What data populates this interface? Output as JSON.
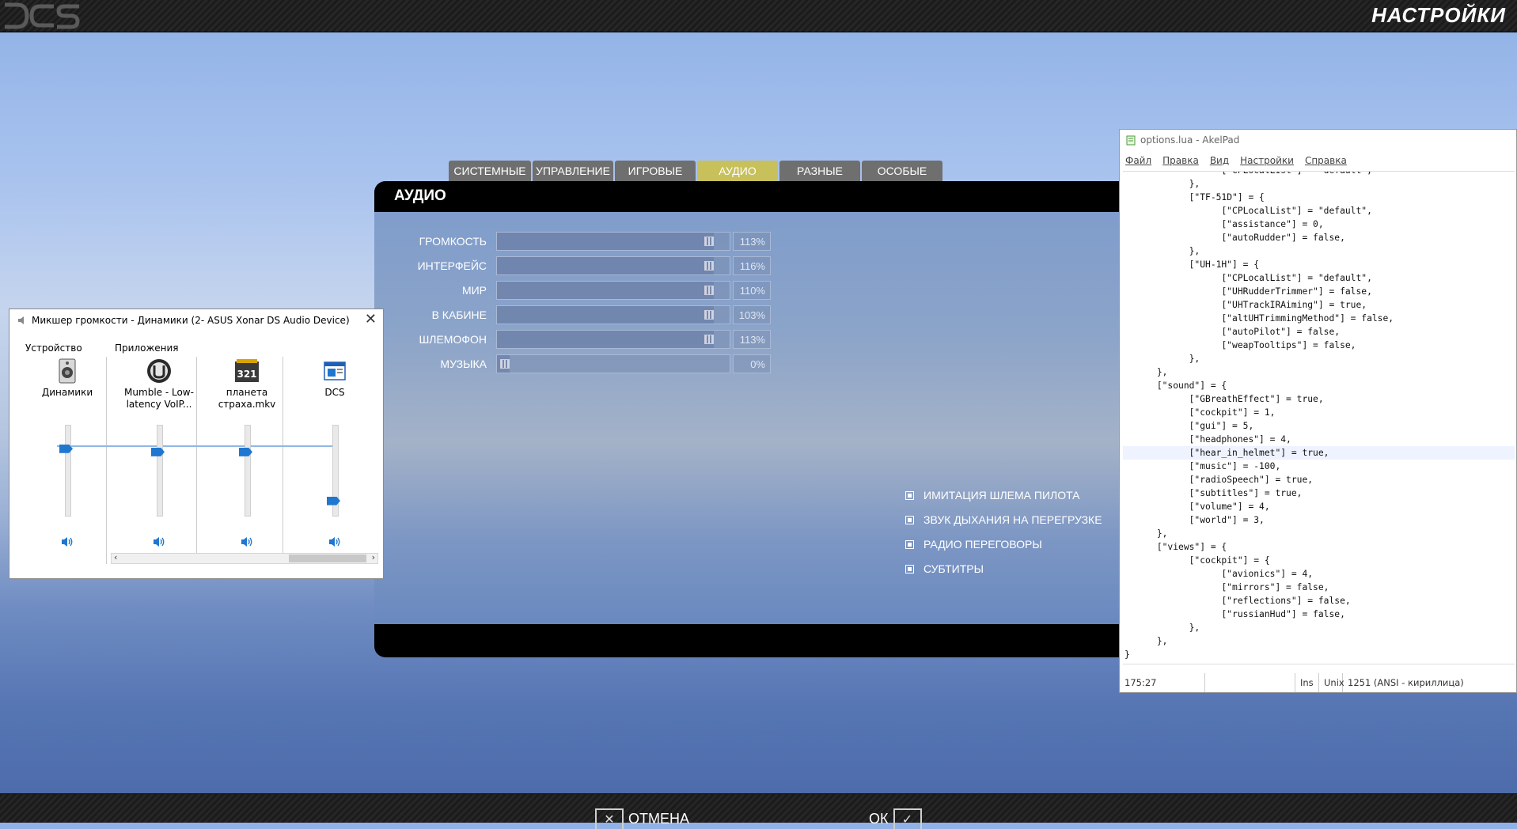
{
  "app": {
    "header_title": "НАСТРОЙКИ"
  },
  "tabs": [
    {
      "label": "СИСТЕМНЫЕ",
      "active": false
    },
    {
      "label": "УПРАВЛЕНИЕ",
      "active": false
    },
    {
      "label": "ИГРОВЫЕ",
      "active": false
    },
    {
      "label": "АУДИО",
      "active": true
    },
    {
      "label": "РАЗНЫЕ",
      "active": false
    },
    {
      "label": "ОСОБЫЕ",
      "active": false
    }
  ],
  "audio": {
    "title": "АУДИО",
    "sliders": [
      {
        "label": "ГРОМКОСТЬ",
        "value": "113%",
        "level": 0.94
      },
      {
        "label": "ИНТЕРФЕЙС",
        "value": "116%",
        "level": 0.94
      },
      {
        "label": "МИР",
        "value": "110%",
        "level": 0.94
      },
      {
        "label": "В КАБИНЕ",
        "value": "103%",
        "level": 0.94
      },
      {
        "label": "ШЛЕМОФОН",
        "value": "113%",
        "level": 0.94
      },
      {
        "label": "МУЗЫКА",
        "value": "0%",
        "level": 0.0
      }
    ],
    "checkboxes": [
      {
        "label": "ИМИТАЦИЯ ШЛЕМА ПИЛОТА",
        "checked": true
      },
      {
        "label": "ЗВУК ДЫХАНИЯ НА ПЕРЕГРУЗКЕ",
        "checked": true
      },
      {
        "label": "РАДИО ПЕРЕГОВОРЫ",
        "checked": true
      },
      {
        "label": "СУБТИТРЫ",
        "checked": true
      }
    ]
  },
  "bottom": {
    "cancel_label": "ОТМЕНА",
    "ok_label": "ОК"
  },
  "mixer": {
    "title": "Микшер громкости - Динамики (2- ASUS Xonar DS Audio Device)",
    "device_section": "Устройство",
    "apps_section": "Приложения",
    "channels": [
      {
        "name": "Динамики",
        "icon": "speaker-device-icon",
        "level": 0.76
      },
      {
        "name": "Mumble - Low-latency VoIP...",
        "icon": "mumble-icon",
        "level": 0.72
      },
      {
        "name": "планета страха.mkv",
        "icon": "media-player-icon",
        "level": 0.72
      },
      {
        "name": "DCS",
        "icon": "dcs-window-icon",
        "level": 0.12
      }
    ]
  },
  "editor": {
    "title": "options.lua - AkelPad",
    "menu": [
      "Файл",
      "Правка",
      "Вид",
      "Настройки",
      "Справка"
    ],
    "code": "\t\t\t[\"CPLocalList\"] = \"default\",\n\t\t},\n\t\t[\"TF-51D\"] = {\n\t\t\t[\"CPLocalList\"] = \"default\",\n\t\t\t[\"assistance\"] = 0,\n\t\t\t[\"autoRudder\"] = false,\n\t\t},\n\t\t[\"UH-1H\"] = {\n\t\t\t[\"CPLocalList\"] = \"default\",\n\t\t\t[\"UHRudderTrimmer\"] = false,\n\t\t\t[\"UHTrackIRAiming\"] = true,\n\t\t\t[\"altUHTrimmingMethod\"] = false,\n\t\t\t[\"autoPilot\"] = false,\n\t\t\t[\"weapTooltips\"] = false,\n\t\t},\n\t},\n\t[\"sound\"] = {\n\t\t[\"GBreathEffect\"] = true,\n\t\t[\"cockpit\"] = 1,\n\t\t[\"gui\"] = 5,\n\t\t[\"headphones\"] = 4,\n\t\t[\"hear_in_helmet\"] = true,\n\t\t[\"music\"] = -100,\n\t\t[\"radioSpeech\"] = true,\n\t\t[\"subtitles\"] = true,\n\t\t[\"volume\"] = 4,\n\t\t[\"world\"] = 3,\n\t},\n\t[\"views\"] = {\n\t\t[\"cockpit\"] = {\n\t\t\t[\"avionics\"] = 4,\n\t\t\t[\"mirrors\"] = false,\n\t\t\t[\"reflections\"] = false,\n\t\t\t[\"russianHud\"] = false,\n\t\t},\n\t},\n}",
    "status": {
      "position": "175:27",
      "mode": "Ins",
      "eol": "Unix",
      "encoding": "1251  (ANSI - кириллица)"
    }
  }
}
